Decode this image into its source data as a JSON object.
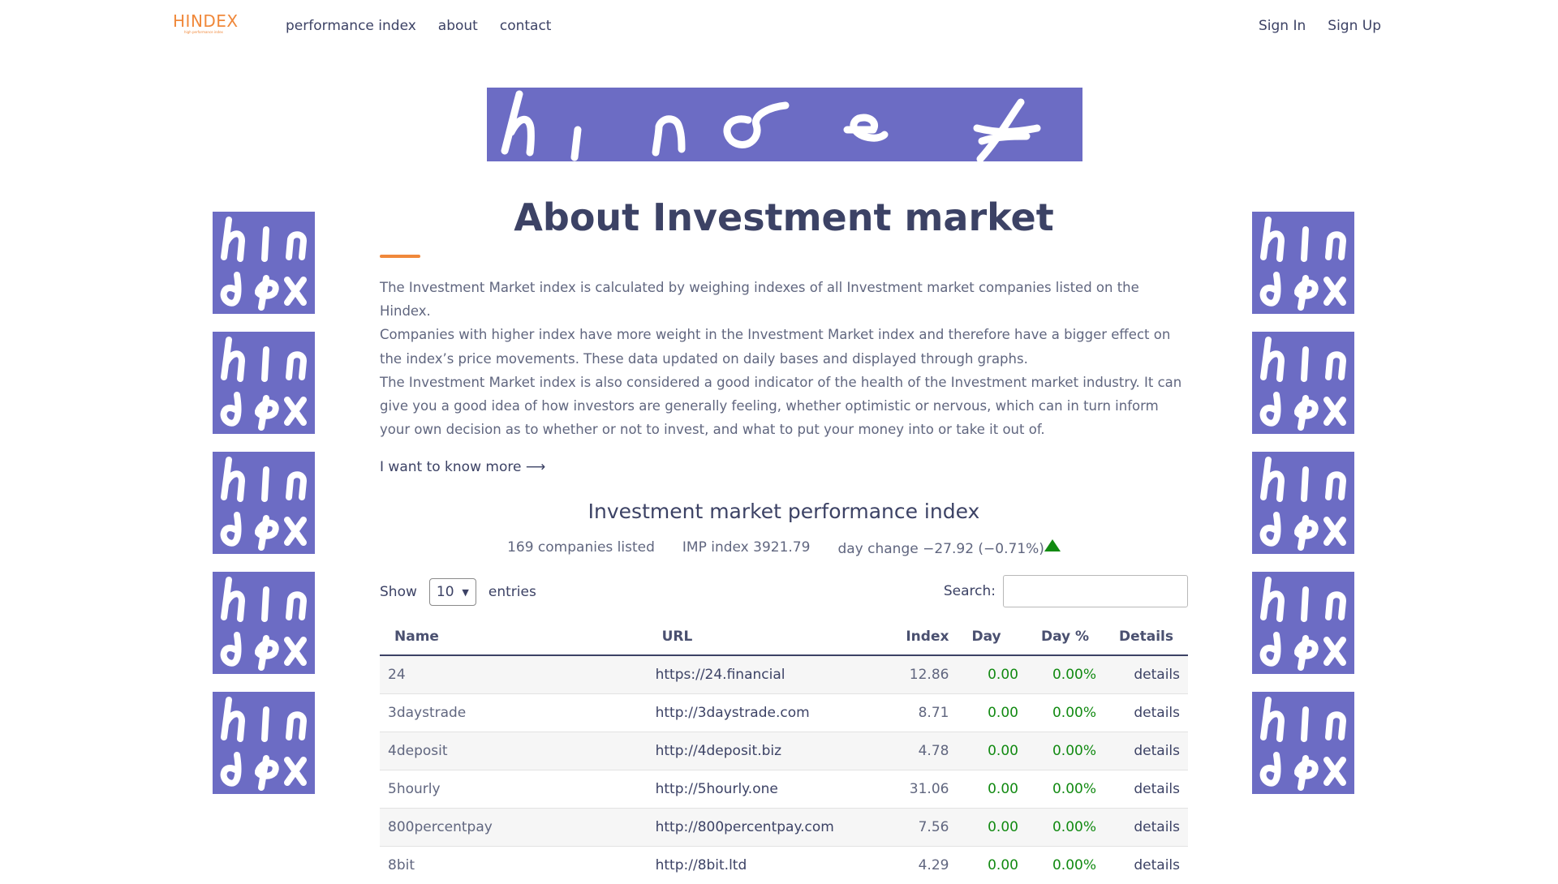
{
  "nav": {
    "logo": "HINDEX",
    "logo_sub": "high performance index",
    "links": [
      "performance index",
      "about",
      "contact"
    ],
    "auth": [
      "Sign In",
      "Sign Up"
    ]
  },
  "page": {
    "title": "About Investment market",
    "paragraphs": [
      "The Investment Market index is calculated by weighing indexes of all Investment market companies listed on the Hindex.",
      "Companies with higher index have more weight in the Investment Market index and therefore have a bigger effect on the index’s price movements. These data updated on daily bases and displayed through graphs.",
      "The Investment Market index is also considered a good indicator of the health of the Investment market industry. It can give you a good idea of how investors are generally feeling, whether optimistic or nervous, which can in turn inform your own decision as to whether or not to invest, and what to put your money into or take it out of."
    ],
    "more_link": "I want to know more ⟶"
  },
  "performance": {
    "title": "Investment market performance index",
    "companies": "169 companies listed",
    "index": "IMP index 3921.79",
    "day_change": "day change −27.92 (−0.71%)"
  },
  "table_controls": {
    "show_label": "Show",
    "entries_value": "10",
    "entries_label": "entries",
    "search_label": "Search:"
  },
  "table": {
    "headers": [
      "Name",
      "URL",
      "Index",
      "Day",
      "Day %",
      "Details"
    ],
    "rows": [
      {
        "name": "24",
        "url": "https://24.financial",
        "index": "12.86",
        "day": "0.00",
        "day_pct": "0.00%",
        "details": "details"
      },
      {
        "name": "3daystrade",
        "url": "http://3daystrade.com",
        "index": "8.71",
        "day": "0.00",
        "day_pct": "0.00%",
        "details": "details"
      },
      {
        "name": "4deposit",
        "url": "http://4deposit.biz",
        "index": "4.78",
        "day": "0.00",
        "day_pct": "0.00%",
        "details": "details"
      },
      {
        "name": "5hourly",
        "url": "http://5hourly.one",
        "index": "31.06",
        "day": "0.00",
        "day_pct": "0.00%",
        "details": "details"
      },
      {
        "name": "800percentpay",
        "url": "http://800percentpay.com",
        "index": "7.56",
        "day": "0.00",
        "day_pct": "0.00%",
        "details": "details"
      },
      {
        "name": "8bit",
        "url": "http://8bit.ltd",
        "index": "4.29",
        "day": "0.00",
        "day_pct": "0.00%",
        "details": "details"
      }
    ]
  },
  "colors": {
    "accent": "#f0883a",
    "brand_purple": "#6c6cc4",
    "positive": "#128a12",
    "text": "#3c4265"
  }
}
